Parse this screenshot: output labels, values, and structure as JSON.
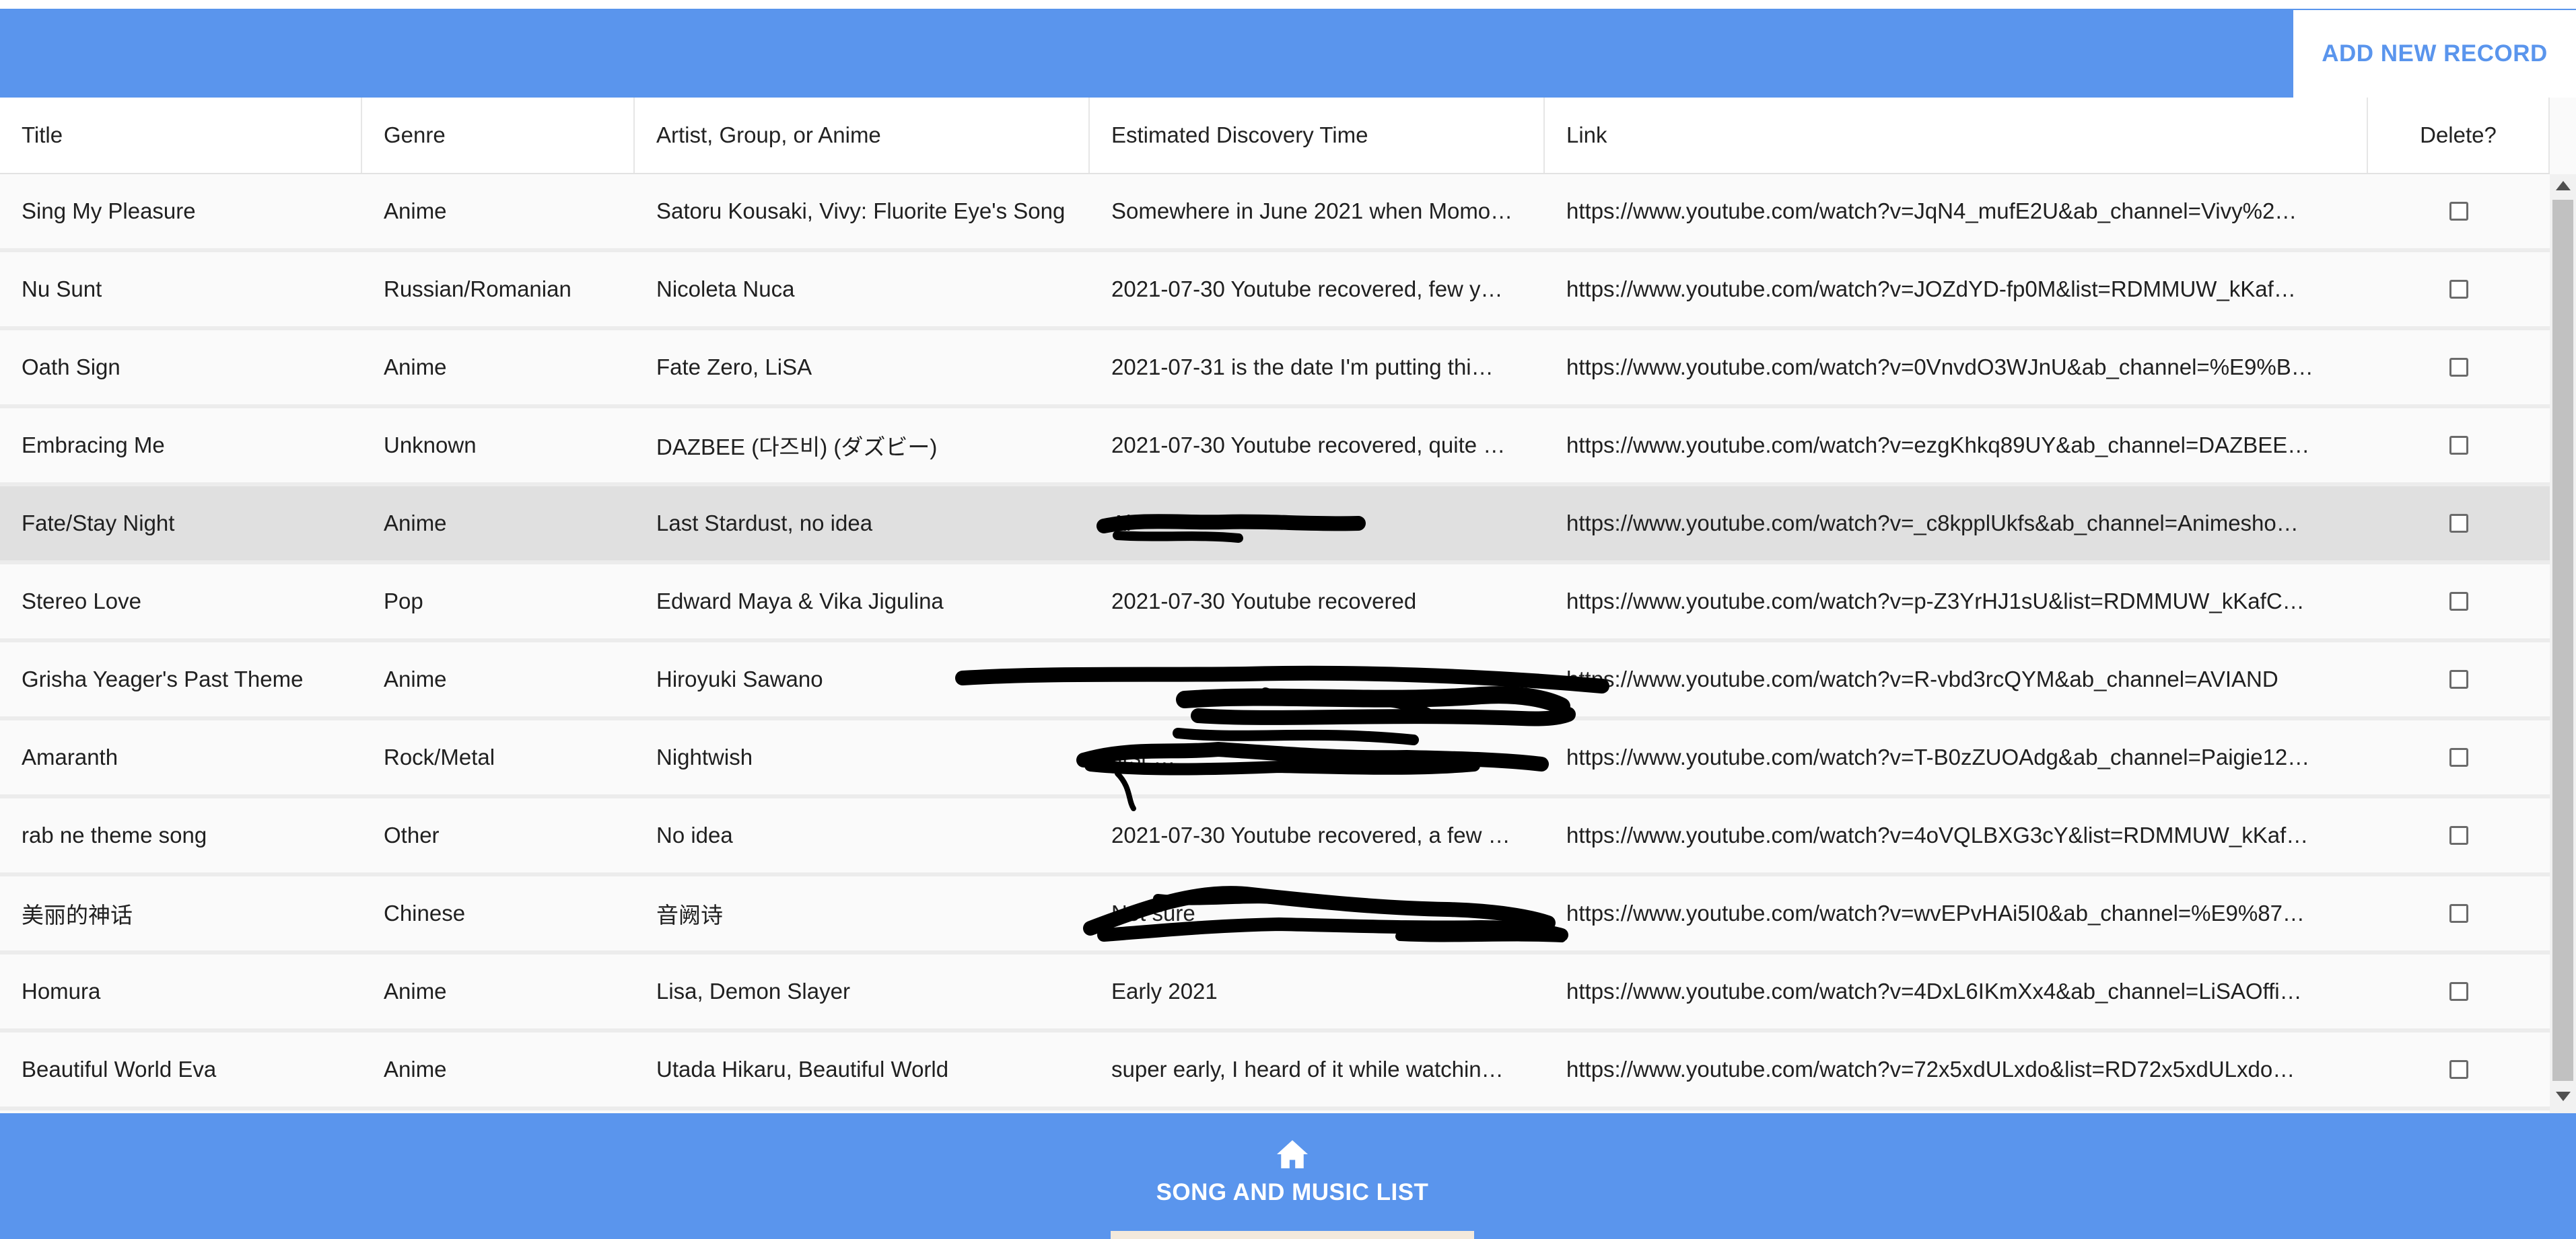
{
  "header": {
    "add_button_label": "ADD NEW RECORD"
  },
  "colors": {
    "primary": "#5a95ed",
    "selected_row": "#e0e0e0",
    "row_bg": "#fafafa",
    "nav_indicator": "#f3e9dc"
  },
  "table": {
    "columns": [
      {
        "key": "title",
        "label": "Title"
      },
      {
        "key": "genre",
        "label": "Genre"
      },
      {
        "key": "artist",
        "label": "Artist, Group, or Anime"
      },
      {
        "key": "discovery",
        "label": "Estimated Discovery Time"
      },
      {
        "key": "link",
        "label": "Link"
      },
      {
        "key": "delete",
        "label": "Delete?"
      }
    ],
    "rows": [
      {
        "title": "Sing My Pleasure",
        "genre": "Anime",
        "artist": "Satoru Kousaki, Vivy: Fluorite Eye's Song",
        "discovery": "Somewhere in June 2021 when Momo…",
        "link": "https://www.youtube.com/watch?v=JqN4_mufE2U&ab_channel=Vivy%2…",
        "selected": false,
        "redacted": false
      },
      {
        "title": "Nu Sunt",
        "genre": "Russian/Romanian",
        "artist": "Nicoleta Nuca",
        "discovery": "2021-07-30 Youtube recovered, few y…",
        "link": "https://www.youtube.com/watch?v=JOZdYD-fp0M&list=RDMMUW_kKaf…",
        "selected": false,
        "redacted": false
      },
      {
        "title": "Oath Sign",
        "genre": "Anime",
        "artist": "Fate Zero, LiSA",
        "discovery": "2021-07-31 is the date I'm putting thi…",
        "link": "https://www.youtube.com/watch?v=0VnvdO3WJnU&ab_channel=%E9%B…",
        "selected": false,
        "redacted": false
      },
      {
        "title": "Embracing Me",
        "genre": "Unknown",
        "artist": "DAZBEE (다즈비) (ダズビー)",
        "discovery": "2021-07-30 Youtube recovered, quite …",
        "link": "https://www.youtube.com/watch?v=ezgKhkq89UY&ab_channel=DAZBEE…",
        "selected": false,
        "redacted": false
      },
      {
        "title": "Fate/Stay Night",
        "genre": "Anime",
        "artist": "Last Stardust, no idea",
        "discovery": "Ai",
        "link": "https://www.youtube.com/watch?v=_c8kpplUkfs&ab_channel=Animesho…",
        "selected": true,
        "redacted": true
      },
      {
        "title": "Stereo Love",
        "genre": "Pop",
        "artist": "Edward Maya & Vika Jigulina",
        "discovery": "2021-07-30 Youtube recovered",
        "link": "https://www.youtube.com/watch?v=p-Z3YrHJ1sU&list=RDMMUW_kKafC…",
        "selected": false,
        "redacted": false
      },
      {
        "title": "Grisha Yeager's Past Theme",
        "genre": "Anime",
        "artist": "Hiroyuki Sawano",
        "discovery": "",
        "link": "https://www.youtube.com/watch?v=R-vbd3rcQYM&ab_channel=AVIAND",
        "selected": false,
        "redacted": true
      },
      {
        "title": "Amaranth",
        "genre": "Rock/Metal",
        "artist": "Nightwish",
        "discovery": "first …",
        "link": "https://www.youtube.com/watch?v=T-B0zZUOAdg&ab_channel=Paigie12…",
        "selected": false,
        "redacted": true
      },
      {
        "title": "rab ne theme song",
        "genre": "Other",
        "artist": "No idea",
        "discovery": "2021-07-30 Youtube recovered, a few …",
        "link": "https://www.youtube.com/watch?v=4oVQLBXG3cY&list=RDMMUW_kKaf…",
        "selected": false,
        "redacted": false
      },
      {
        "title": "美丽的神话",
        "genre": "Chinese",
        "artist": "音阙诗",
        "discovery": "Not sure",
        "link": "https://www.youtube.com/watch?v=wvEPvHAi5I0&ab_channel=%E9%87…",
        "selected": false,
        "redacted": true
      },
      {
        "title": "Homura",
        "genre": "Anime",
        "artist": "Lisa, Demon Slayer",
        "discovery": "Early 2021",
        "link": "https://www.youtube.com/watch?v=4DxL6IKmXx4&ab_channel=LiSAOffi…",
        "selected": false,
        "redacted": false
      },
      {
        "title": "Beautiful World Eva",
        "genre": "Anime",
        "artist": "Utada Hikaru, Beautiful World",
        "discovery": "super early, I heard of it while watchin…",
        "link": "https://www.youtube.com/watch?v=72x5xdULxdo&list=RD72x5xdULxdo…",
        "selected": false,
        "redacted": false
      }
    ]
  },
  "bottom_nav": {
    "icon": "home-icon",
    "label": "SONG AND MUSIC LIST"
  }
}
